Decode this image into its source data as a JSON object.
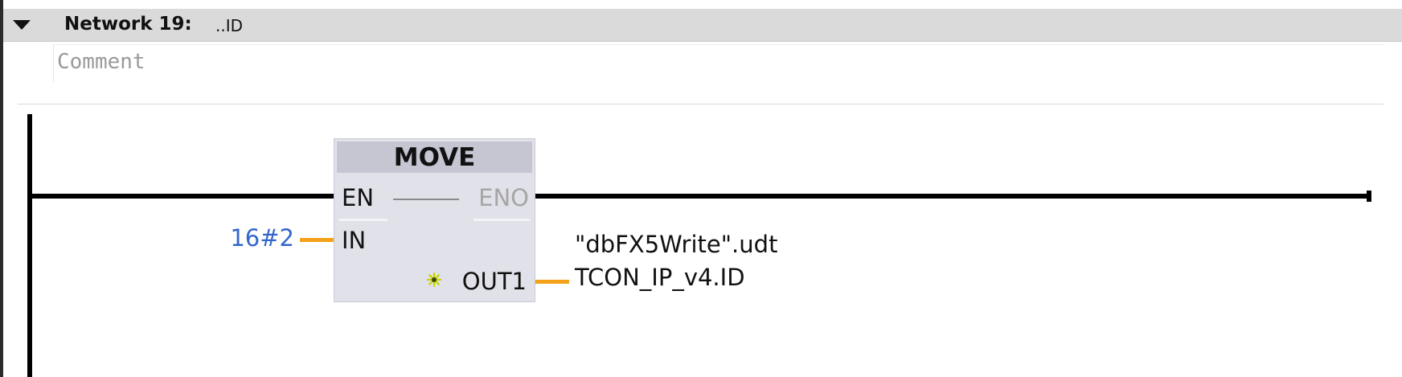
{
  "network": {
    "label": "Network 19:",
    "title": "..ID",
    "comment_placeholder": "Comment"
  },
  "move_block": {
    "name": "MOVE",
    "pins": {
      "en": "EN",
      "eno": "ENO",
      "in": "IN",
      "out1": "OUT1"
    }
  },
  "operands": {
    "in_value": "16#2",
    "out_line1": "\"dbFX5Write\".udt",
    "out_line2": "TCON_IP_v4.ID"
  },
  "colors": {
    "power_rail": "#000000",
    "connection_orange": "#f5a21b",
    "constant_blue": "#3366cc",
    "header_gray": "#dadada",
    "block_body": "#e1e1e9",
    "block_header": "#c6c6d3",
    "new_pin_icon": "#c8d400"
  },
  "icons": {
    "collapse_toggle": "triangle-down-icon",
    "new_output": "star-new-pin-icon"
  }
}
